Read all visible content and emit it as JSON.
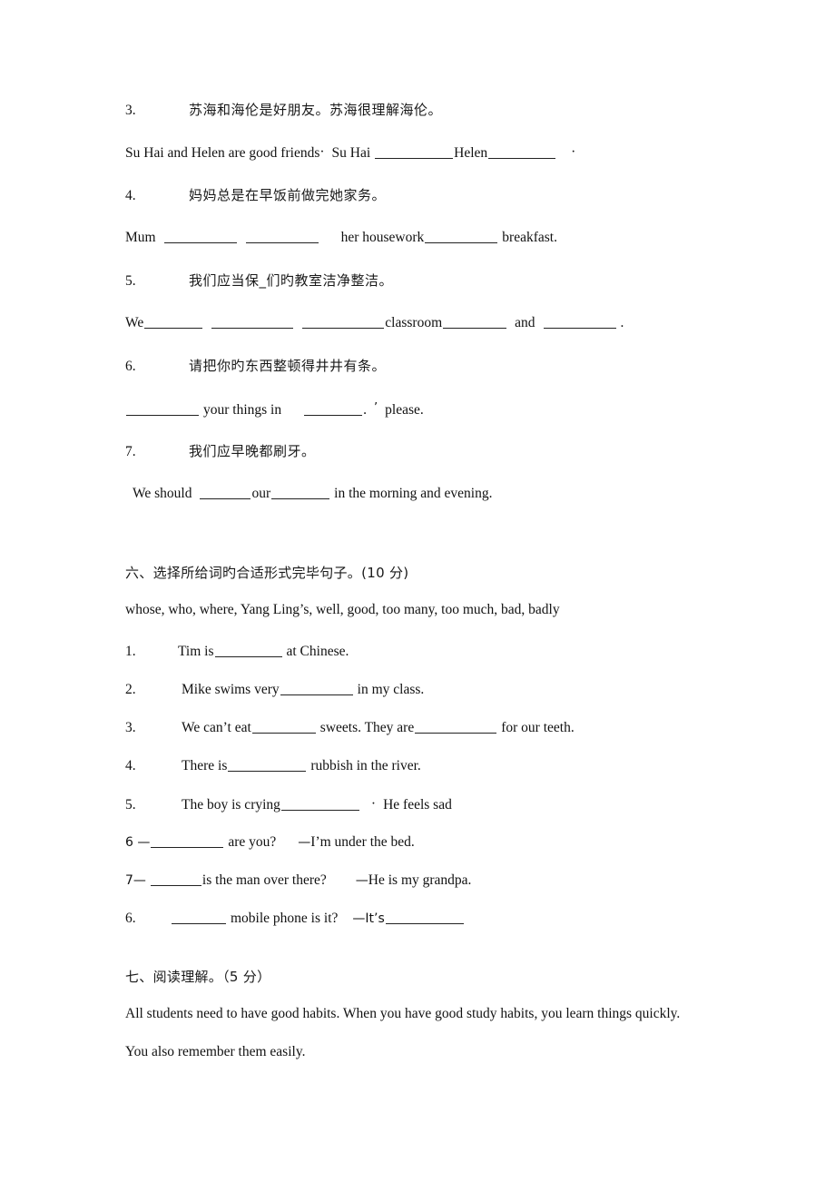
{
  "document": {
    "type": "english-exam-worksheet",
    "page_background": "#ffffff",
    "text_color": "#111111"
  },
  "translation_section": {
    "items": [
      {
        "number": "3.",
        "chinese": "苏海和海伦是好朋友。苏海很理解海伦。",
        "english_prefix": "Su Hai and Helen are good friends",
        "punct1": "·",
        "english_mid": "Su Hai",
        "english_after_blank1": "Helen",
        "punct2": "·"
      },
      {
        "number": "4.",
        "chinese": "妈妈总是在早饭前做完她家务。",
        "english_prefix": "Mum",
        "english_mid": "her housework",
        "english_suffix": "breakfast."
      },
      {
        "number": "5.",
        "chinese": "我们应当保_们旳教室洁净整洁。",
        "english_prefix": "We",
        "english_mid": "classroom",
        "english_conj": "and",
        "english_suffix": "."
      },
      {
        "number": "6.",
        "chinese": "请把你旳东西整顿得井井有条。",
        "english_mid": "your   things   in",
        "english_dot": ".",
        "english_apos": "’",
        "english_suffix": "please."
      },
      {
        "number": "7.",
        "chinese": "我们应早晚都刷牙。",
        "english_prefix": "We should",
        "english_mid": "our",
        "english_suffix": "in the morning and evening."
      }
    ]
  },
  "section_six": {
    "heading": "六、选择所给旳合适形式完毕句子。(10 分)",
    "heading_text": "六、选择所给词旳合适形式完毕句子。(10 分)",
    "word_bank": "whose, who, where, Yang Ling’s, well, good, too many, too much, bad, badly",
    "questions": [
      {
        "number": "1.",
        "before": "Tim is",
        "after": "at Chinese."
      },
      {
        "number": "2.",
        "before": "Mike swims very",
        "after": "in my class."
      },
      {
        "number": "3.",
        "before": "We can’t eat",
        "mid": "sweets. They are",
        "after": "for our teeth."
      },
      {
        "number": "4.",
        "before": "There is",
        "after": "rubbish in the river."
      },
      {
        "number": "5.",
        "before": "The boy is crying",
        "dot": "·",
        "after": "He feels sad"
      },
      {
        "number": "6 —",
        "before": "",
        "mid": "are you?",
        "answer_dash": "—",
        "after": "I’m under the bed."
      },
      {
        "number": "7—",
        "before": "",
        "mid": "is the man over there?",
        "answer_dash": "—",
        "after": "He is my grandpa."
      },
      {
        "number": "6.",
        "before": "",
        "mid": "mobile phone is it?",
        "answer_dash": "—It’s",
        "after": ""
      }
    ]
  },
  "section_seven": {
    "heading": "七、阅读理解。（5 分）",
    "passage_line1": "All students need to have good habits. When you have good study habits, you learn things quickly.",
    "passage_line2": "You also remember them easily."
  }
}
